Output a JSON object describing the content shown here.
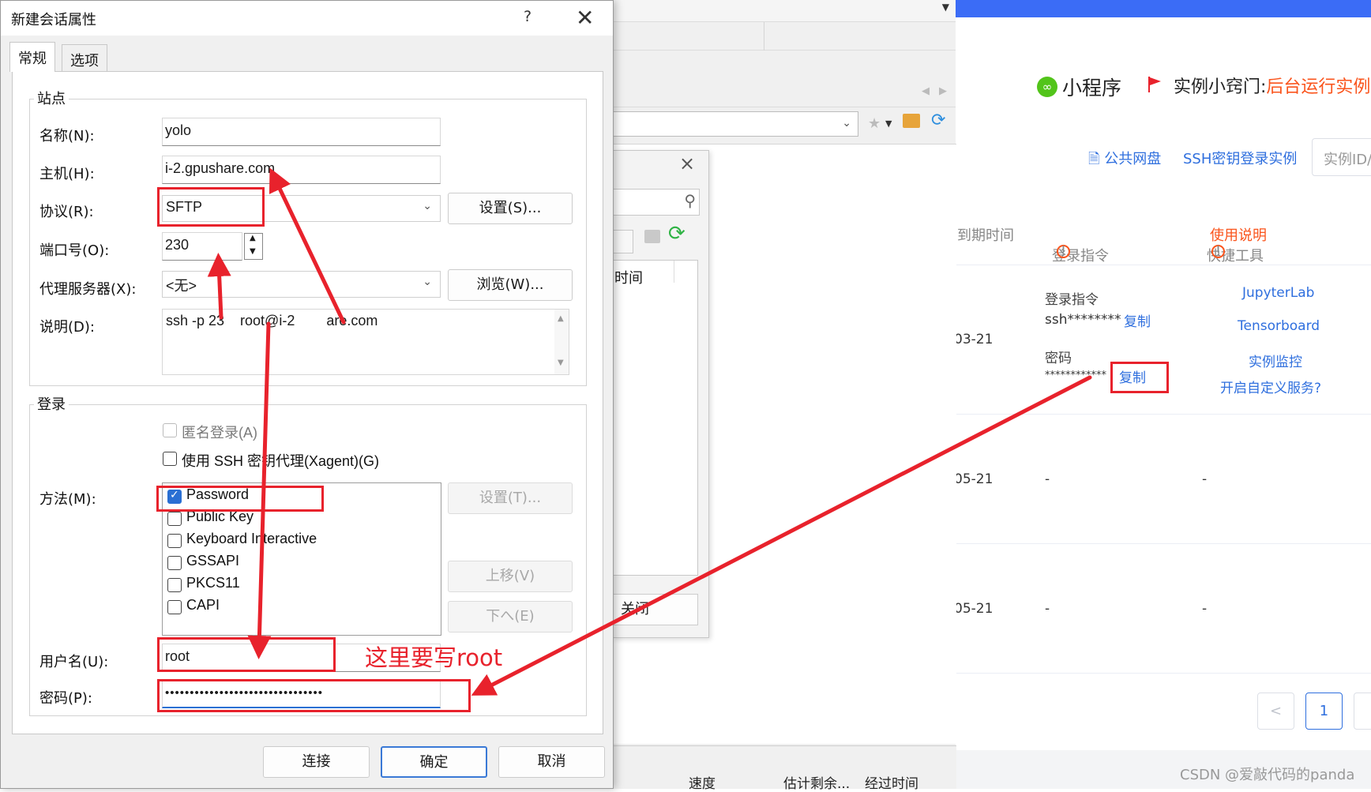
{
  "web": {
    "miniapp": "小程序",
    "tip_prefix": "实例小窍门:",
    "tip_highlight": "后台运行实例",
    "link_netdisk": "公共网盘",
    "link_sshkey": "SSH密钥登录实例",
    "search_placeholder": "实例ID/",
    "col_expire": "到期时间",
    "col_login": "登录指令",
    "col_tools": "快捷工具",
    "col_tools_help": "使用说明",
    "row1": {
      "date": "03-21",
      "login_label": "登录指令",
      "login_value": "ssh********",
      "copy1": "复制",
      "pwd_label": "密码",
      "pwd_value": "************",
      "copy2": "复制",
      "tool1": "JupyterLab",
      "tool2": "Tensorboard",
      "tool3": "实例监控",
      "tool4": "开启自定义服务?"
    },
    "row2": {
      "date": "05-21",
      "login": "-",
      "tools": "-"
    },
    "row3": {
      "date": "05-21",
      "login": "-",
      "tools": "-"
    },
    "page_prev": "<",
    "page_current": "1",
    "watermark": "CSDN @爱敲代码的panda"
  },
  "mid": {
    "time_col": "时间",
    "close_btn": "关闭",
    "col_speed": "速度",
    "col_remaining": "估计剩余...",
    "col_elapsed": "经过时间"
  },
  "dialog": {
    "title": "新建会话属性",
    "help": "?",
    "close": "✕",
    "tab_general": "常规",
    "tab_options": "选项",
    "site_group": "站点",
    "name_label": "名称(N):",
    "name_value": "yolo",
    "host_label": "主机(H):",
    "host_value": "i-2.gpushare.com",
    "protocol_label": "协议(R):",
    "protocol_value": "SFTP",
    "settings_btn": "设置(S)...",
    "port_label": "端口号(O):",
    "port_value": "230",
    "proxy_label": "代理服务器(X):",
    "proxy_value": "<无>",
    "browse_btn": "浏览(W)...",
    "desc_label": "说明(D):",
    "desc_value": "ssh -p 23    root@i-2        are.com",
    "login_group": "登录",
    "anon_label": "匿名登录(A)",
    "agent_label": "使用 SSH 密钥代理(Xagent)(G)",
    "method_label": "方法(M):",
    "methods": [
      {
        "label": "Password",
        "checked": true
      },
      {
        "label": "Public Key",
        "checked": false
      },
      {
        "label": "Keyboard Interactive",
        "checked": false
      },
      {
        "label": "GSSAPI",
        "checked": false
      },
      {
        "label": "PKCS11",
        "checked": false
      },
      {
        "label": "CAPI",
        "checked": false
      }
    ],
    "method_settings_btn": "设置(T)...",
    "move_up_btn": "上移(V)",
    "move_down_btn": "下へ(E)",
    "user_label": "用户名(U):",
    "user_value": "root",
    "pwd_label": "密码(P):",
    "pwd_value": "••••••••••••••••••••••••••••••••",
    "connect_btn": "连接",
    "ok_btn": "确定",
    "cancel_btn": "取消"
  },
  "annotation": {
    "text": "这里要写root",
    "color": "#e8222c"
  }
}
